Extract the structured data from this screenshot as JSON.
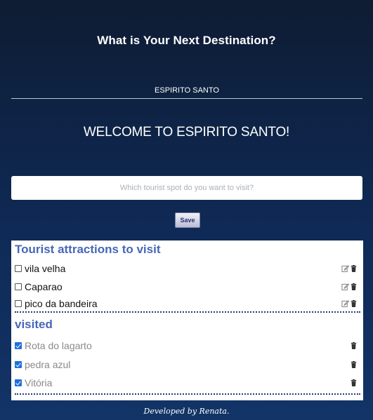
{
  "header": {
    "title": "What is Your Next Destination?"
  },
  "destination": {
    "value": "ESPIRITO SANTO"
  },
  "welcome": {
    "text": "WELCOME TO ESPIRITO SANTO!"
  },
  "spot_input": {
    "value": "",
    "placeholder": "Which tourist spot do you want to visit?"
  },
  "save_button": {
    "label": "Save"
  },
  "to_visit": {
    "title": "Tourist attractions to visit",
    "items": [
      {
        "label": "vila velha",
        "checked": false
      },
      {
        "label": "Caparao",
        "checked": false
      },
      {
        "label": "pico da bandeira",
        "checked": false
      }
    ]
  },
  "visited": {
    "title": "visited",
    "items": [
      {
        "label": "Rota do lagarto",
        "checked": true
      },
      {
        "label": "pedra azul",
        "checked": true
      },
      {
        "label": "Vitória",
        "checked": true
      }
    ]
  },
  "footer": {
    "text": "Developed by Renata."
  },
  "colors": {
    "background_top": "#0e1c33",
    "background_bottom": "#123467",
    "section_title": "#4667b6",
    "checkbox_checked": "#1e6fe0",
    "divider": "#1f3d75"
  },
  "icons": {
    "edit": "edit-icon",
    "delete": "trash-icon"
  }
}
